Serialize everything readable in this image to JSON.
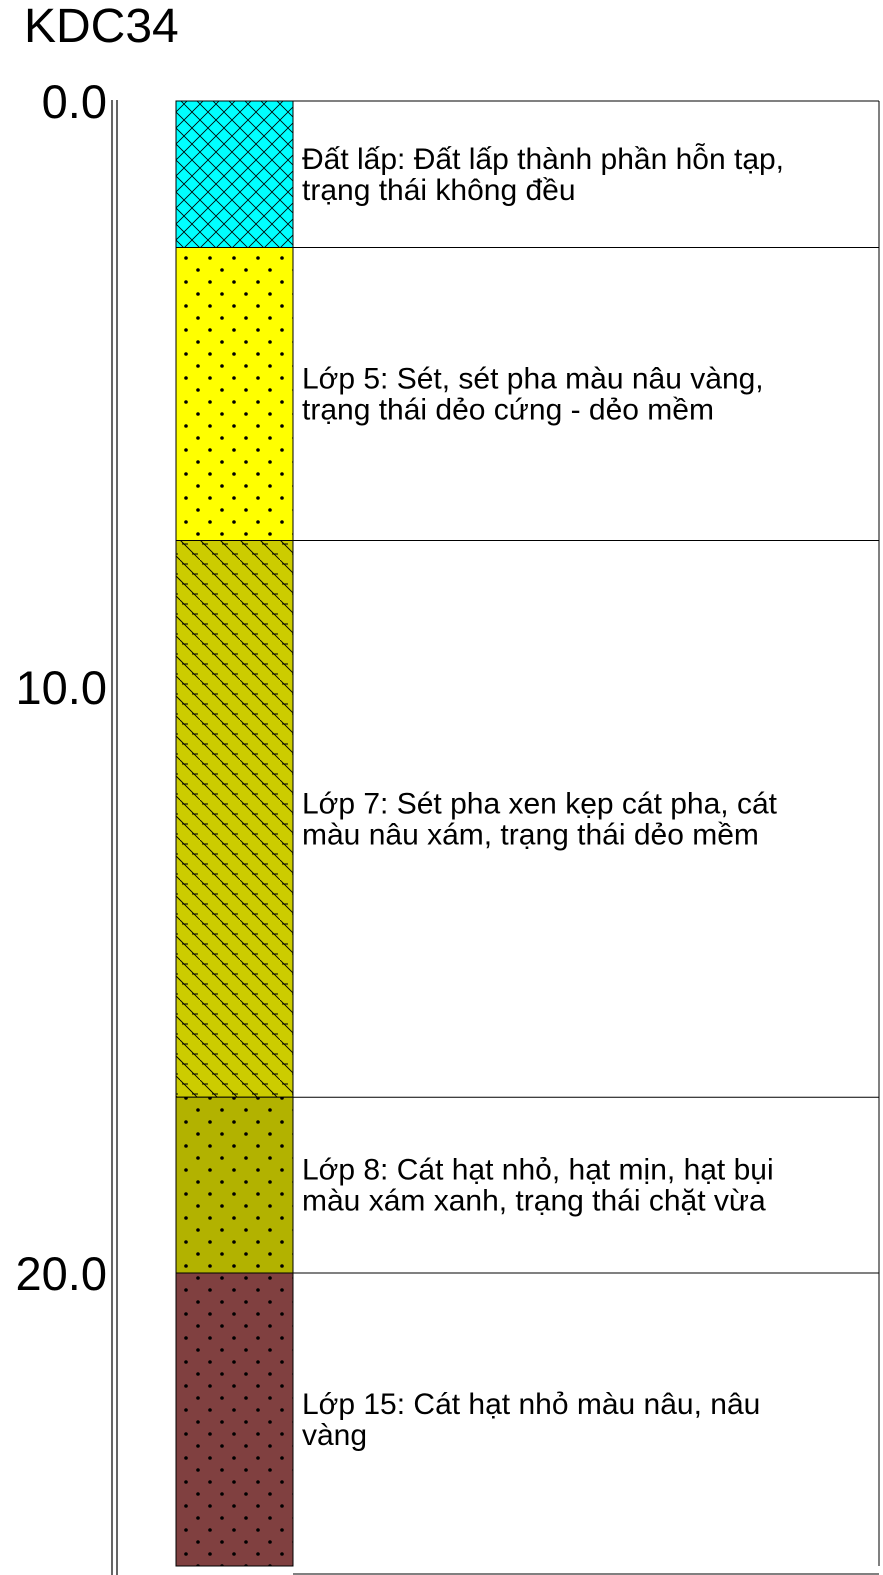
{
  "title": "KDC34",
  "depth_axis": {
    "ticks": [
      {
        "value": 0,
        "label": "0.0"
      },
      {
        "value": 10,
        "label": "10.0"
      },
      {
        "value": 20,
        "label": "20.0"
      }
    ]
  },
  "layers": [
    {
      "id": "fill",
      "top": 0.0,
      "bottom": 2.5,
      "pattern": "crosshatch",
      "color": "#00ffff",
      "lines": [
        "Đất lấp: Đất lấp thành phần hỗn tạp,",
        "trạng thái không đều"
      ]
    },
    {
      "id": "layer-5",
      "top": 2.5,
      "bottom": 7.5,
      "pattern": "dots",
      "color": "#ffff00",
      "lines": [
        "Lớp 5: Sét, sét pha màu nâu vàng,",
        "trạng thái dẻo cứng - dẻo mềm"
      ]
    },
    {
      "id": "layer-7",
      "top": 7.5,
      "bottom": 17.0,
      "pattern": "dash-diagonal",
      "color": "#cccc00",
      "lines": [
        "Lớp 7: Sét pha xen kẹp cát pha, cát",
        "màu nâu xám, trạng thái dẻo mềm"
      ]
    },
    {
      "id": "layer-8",
      "top": 17.0,
      "bottom": 20.0,
      "pattern": "dots",
      "color": "#b2b200",
      "lines": [
        "Lớp 8: Cát hạt nhỏ, hạt mịn, hạt bụi",
        "màu xám xanh, trạng thái chặt vừa"
      ]
    },
    {
      "id": "layer-15",
      "top": 20.0,
      "bottom": 25.0,
      "pattern": "dots",
      "color": "#804040",
      "lines": [
        "Lớp 15: Cát hạt nhỏ màu nâu, nâu",
        "vàng"
      ]
    }
  ]
}
